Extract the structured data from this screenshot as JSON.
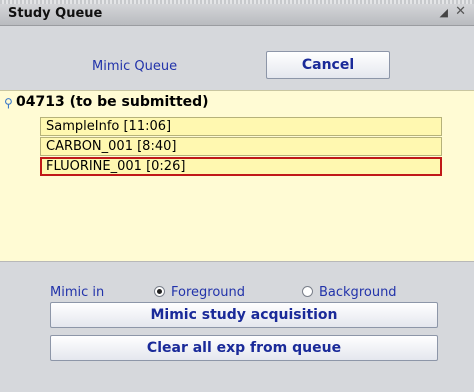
{
  "window": {
    "title": "Study Queue",
    "pin_glyph": "⊿",
    "close_glyph": "✕"
  },
  "top": {
    "mimic_queue_label": "Mimic Queue",
    "cancel_label": "Cancel"
  },
  "queue": {
    "header": "04713 (to be submitted)",
    "items": [
      {
        "label": "SampleInfo [11:06]"
      },
      {
        "label": "CARBON_001 [8:40]"
      },
      {
        "label": "FLUORINE_001 [0:26]",
        "selected": true
      }
    ]
  },
  "mimic": {
    "label": "Mimic in",
    "options": [
      {
        "label": "Foreground",
        "checked": true
      },
      {
        "label": "Background",
        "checked": false
      }
    ]
  },
  "actions": {
    "mimic_study": "Mimic study acquisition",
    "clear_all": "Clear all exp from queue"
  },
  "colors": {
    "accent_text": "#2233aa",
    "queue_bg": "#fffbd4",
    "selection_border": "#c01818"
  }
}
